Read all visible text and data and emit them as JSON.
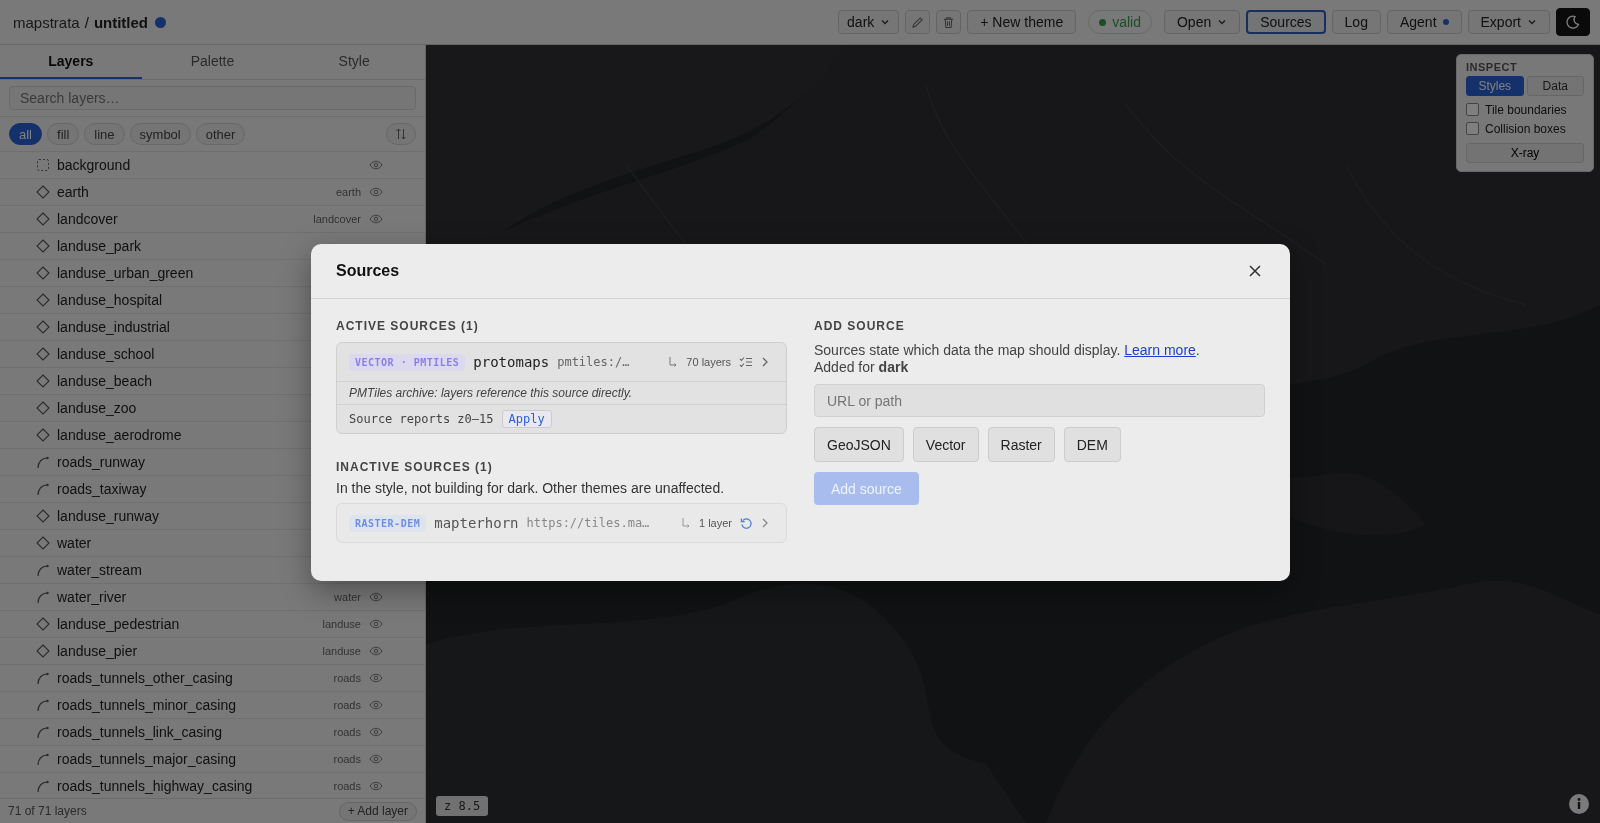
{
  "app": {
    "name": "mapstrata",
    "separator": "/",
    "document": "untitled",
    "unsaved": true
  },
  "toolbar": {
    "theme": "dark",
    "new_theme": "+ New theme",
    "status": "valid",
    "buttons": [
      {
        "label": "Open",
        "kind": "menu",
        "selected": false
      },
      {
        "label": "Sources",
        "kind": "plain",
        "selected": true
      },
      {
        "label": "Log",
        "kind": "plain",
        "selected": false
      },
      {
        "label": "Agent",
        "kind": "dot",
        "selected": false
      },
      {
        "label": "Export",
        "kind": "menu",
        "selected": false
      }
    ]
  },
  "sidebar": {
    "tabs": [
      {
        "label": "Layers",
        "selected": true
      },
      {
        "label": "Palette",
        "selected": false
      },
      {
        "label": "Style",
        "selected": false
      }
    ],
    "search": {
      "placeholder": "Search layers…"
    },
    "filters": [
      {
        "label": "all",
        "selected": true
      },
      {
        "label": "fill",
        "selected": false
      },
      {
        "label": "line",
        "selected": false
      },
      {
        "label": "symbol",
        "selected": false
      },
      {
        "label": "other",
        "selected": false
      }
    ],
    "layers": [
      {
        "name": "background",
        "kind": "background"
      },
      {
        "name": "earth",
        "kind": "fill",
        "source": "earth"
      },
      {
        "name": "landcover",
        "kind": "fill",
        "source": "landcover"
      },
      {
        "name": "landuse_park",
        "kind": "fill"
      },
      {
        "name": "landuse_urban_green",
        "kind": "fill"
      },
      {
        "name": "landuse_hospital",
        "kind": "fill"
      },
      {
        "name": "landuse_industrial",
        "kind": "fill"
      },
      {
        "name": "landuse_school",
        "kind": "fill"
      },
      {
        "name": "landuse_beach",
        "kind": "fill"
      },
      {
        "name": "landuse_zoo",
        "kind": "fill"
      },
      {
        "name": "landuse_aerodrome",
        "kind": "fill"
      },
      {
        "name": "roads_runway",
        "kind": "line"
      },
      {
        "name": "roads_taxiway",
        "kind": "line"
      },
      {
        "name": "landuse_runway",
        "kind": "fill"
      },
      {
        "name": "water",
        "kind": "fill"
      },
      {
        "name": "water_stream",
        "kind": "line"
      },
      {
        "name": "water_river",
        "kind": "line",
        "source": "water"
      },
      {
        "name": "landuse_pedestrian",
        "kind": "fill",
        "source": "landuse"
      },
      {
        "name": "landuse_pier",
        "kind": "fill",
        "source": "landuse"
      },
      {
        "name": "roads_tunnels_other_casing",
        "kind": "line",
        "source": "roads"
      },
      {
        "name": "roads_tunnels_minor_casing",
        "kind": "line",
        "source": "roads"
      },
      {
        "name": "roads_tunnels_link_casing",
        "kind": "line",
        "source": "roads"
      },
      {
        "name": "roads_tunnels_major_casing",
        "kind": "line",
        "source": "roads"
      },
      {
        "name": "roads_tunnels_highway_casing",
        "kind": "line",
        "source": "roads"
      }
    ],
    "count": "71 of 71 layers",
    "add": "+ Add layer"
  },
  "inspect": {
    "title": "INSPECT",
    "modes": [
      {
        "label": "Styles",
        "selected": true
      },
      {
        "label": "Data",
        "selected": false
      }
    ],
    "options": [
      {
        "label": "Tile boundaries",
        "checked": false
      },
      {
        "label": "Collision boxes",
        "checked": false
      }
    ],
    "xray": "X-ray"
  },
  "map": {
    "zoom": "z 8.5"
  },
  "dialog": {
    "title": "Sources",
    "active_heading": "ACTIVE SOURCES (1)",
    "active": [
      {
        "type": "VECTOR · PMTILES",
        "color": "#8a7df0",
        "name": "protomaps",
        "url": "pmtiles:/…",
        "layers": "70 layers",
        "note": "PMTiles archive: layers reference this source directly.",
        "zoom_note": "Source reports z0–15",
        "action": "Apply"
      }
    ],
    "inactive_heading": "INACTIVE SOURCES (1)",
    "inactive_note": "In the style, not building for dark. Other themes are unaffected.",
    "inactive": [
      {
        "type": "RASTER-DEM",
        "color": "#6a8fe6",
        "name": "mapterhorn",
        "url": "https://tiles.ma…",
        "layers": "1 layer"
      }
    ],
    "add": {
      "heading": "ADD SOURCE",
      "text": "Sources state which data the map should display.",
      "link": "Learn more",
      "after_link": ".",
      "added_for": "Added for **dark**",
      "placeholder": "URL or path",
      "types": [
        "GeoJSON",
        "Vector",
        "Raster",
        "DEM"
      ],
      "submit": "Add source",
      "submit_disabled": true
    }
  }
}
